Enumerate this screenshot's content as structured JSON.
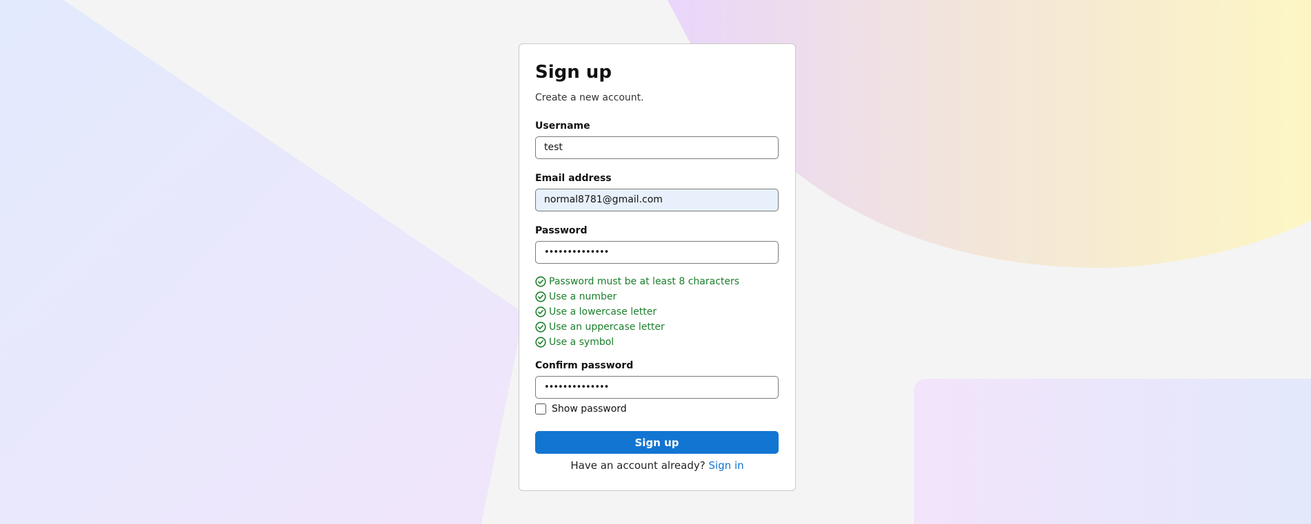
{
  "theme": {
    "accent": "#1275d2",
    "success": "#1a7f2a",
    "autofill_bg": "#e8f0fb"
  },
  "form": {
    "title": "Sign up",
    "subtitle": "Create a new account.",
    "username": {
      "label": "Username",
      "value": "test"
    },
    "email": {
      "label": "Email address",
      "value": "normal8781@gmail.com"
    },
    "password": {
      "label": "Password",
      "value": "••••••••••••••"
    },
    "rules": [
      {
        "text": "Password must be at least 8 characters",
        "icon": "check-circle-icon",
        "met": true
      },
      {
        "text": "Use a number",
        "icon": "check-circle-icon",
        "met": true
      },
      {
        "text": "Use a lowercase letter",
        "icon": "check-circle-icon",
        "met": true
      },
      {
        "text": "Use an uppercase letter",
        "icon": "check-circle-icon",
        "met": true
      },
      {
        "text": "Use a symbol",
        "icon": "check-circle-icon",
        "met": true
      }
    ],
    "confirm": {
      "label": "Confirm password",
      "value": "••••••••••••••"
    },
    "show_password": {
      "label": "Show password",
      "checked": false
    },
    "submit_label": "Sign up",
    "footer": {
      "prompt": "Have an account already?",
      "link": "Sign in"
    }
  }
}
